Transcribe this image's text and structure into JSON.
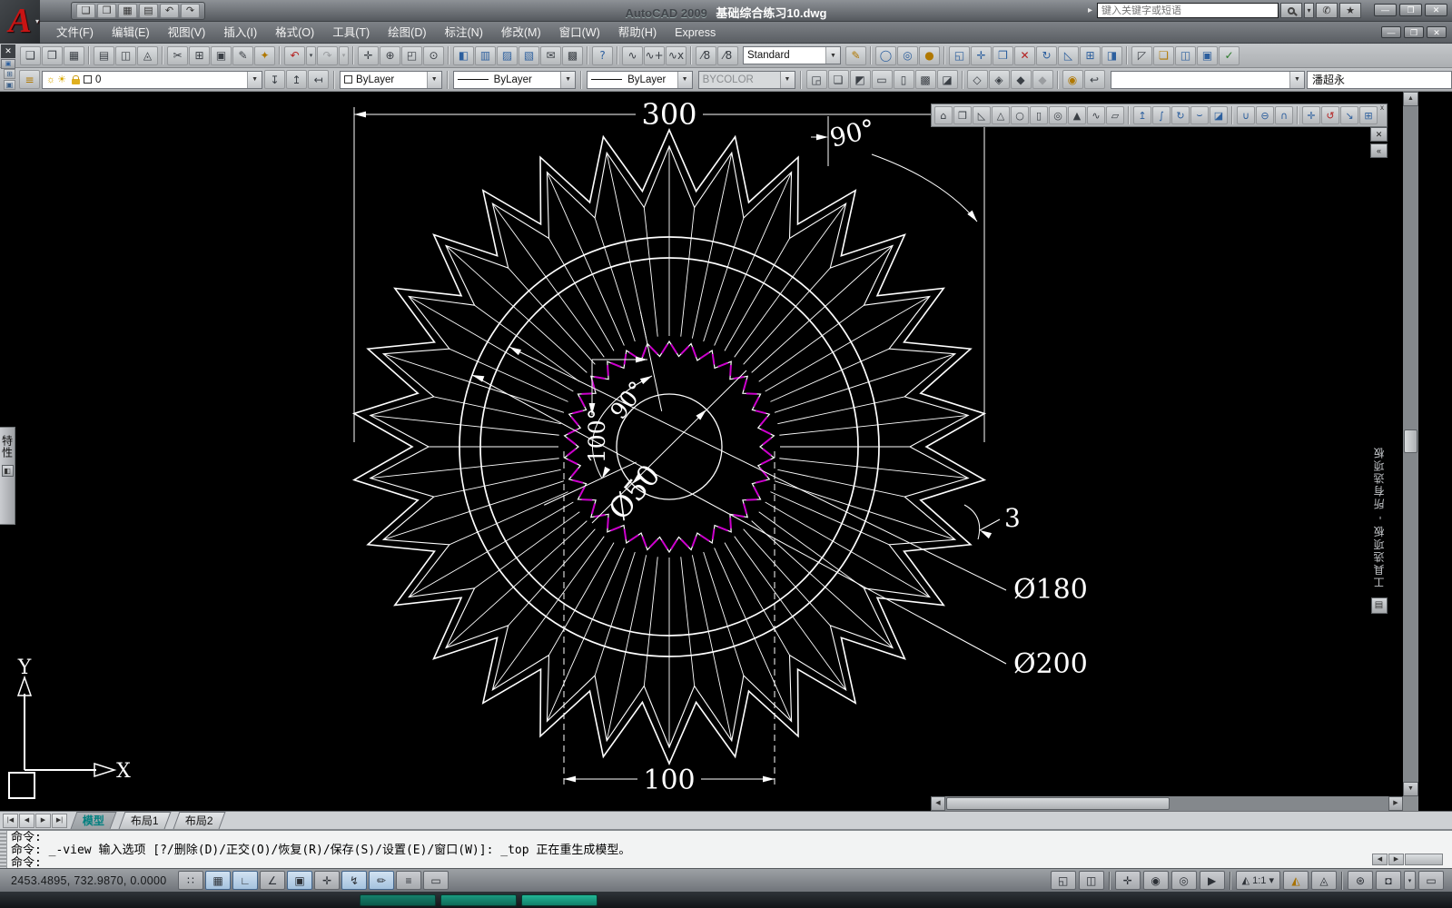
{
  "colors": {
    "dim_line": "#ffffff",
    "inner_gear_magenta": "#cc00cc",
    "tab_active_teal": "#007f7f"
  },
  "titlebar": {
    "app_label": "AutoCAD 2009",
    "doc_title": "基础综合练习10.dwg",
    "search_placeholder": "键入关键字或短语",
    "expand_arrow": "▸",
    "quick_icons": [
      {
        "name": "qnew-icon",
        "glyph": "❑"
      },
      {
        "name": "open-icon",
        "glyph": "❒"
      },
      {
        "name": "save-icon",
        "glyph": "▦"
      },
      {
        "name": "plot-icon",
        "glyph": "▤"
      },
      {
        "name": "undo-icon",
        "glyph": "↶"
      },
      {
        "name": "redo-icon",
        "glyph": "↷"
      }
    ],
    "search_buttons": [
      {
        "name": "search-dropdown",
        "glyph": "▾",
        "cls": "narrow"
      },
      {
        "name": "comm-center-icon",
        "glyph": "✆"
      },
      {
        "name": "favorites-star-icon",
        "glyph": "★"
      }
    ],
    "window_buttons": [
      {
        "name": "minimize-button",
        "glyph": "—"
      },
      {
        "name": "restore-button",
        "glyph": "❐"
      },
      {
        "name": "close-button",
        "glyph": "✕"
      }
    ],
    "doc_window_buttons": [
      {
        "name": "doc-minimize-button",
        "glyph": "—"
      },
      {
        "name": "doc-restore-button",
        "glyph": "❐"
      },
      {
        "name": "doc-close-button",
        "glyph": "✕"
      }
    ]
  },
  "menubar": {
    "items": [
      "文件(F)",
      "编辑(E)",
      "视图(V)",
      "插入(I)",
      "格式(O)",
      "工具(T)",
      "绘图(D)",
      "标注(N)",
      "修改(M)",
      "窗口(W)",
      "帮助(H)",
      "Express"
    ]
  },
  "left_dock": {
    "close_glyph": "✕",
    "grip_glyph": "▣"
  },
  "toolbar1": {
    "style_combo": "Standard",
    "icons": [
      {
        "name": "qnew-icon",
        "glyph": "❑"
      },
      {
        "name": "open-icon",
        "glyph": "❒"
      },
      {
        "name": "save-icon",
        "glyph": "▦"
      },
      {
        "sep": true
      },
      {
        "name": "plot-icon",
        "glyph": "▤"
      },
      {
        "name": "plot-preview-icon",
        "glyph": "◫"
      },
      {
        "name": "publish-icon",
        "glyph": "◬"
      },
      {
        "sep": true
      },
      {
        "name": "cut-icon",
        "glyph": "✂"
      },
      {
        "name": "copy-icon",
        "glyph": "⊞"
      },
      {
        "name": "paste-icon",
        "glyph": "▣"
      },
      {
        "name": "match-properties-icon",
        "glyph": "✎"
      },
      {
        "name": "block-editor-icon",
        "glyph": "✦",
        "cls": "warn"
      },
      {
        "sep": true
      },
      {
        "name": "undo-icon",
        "glyph": "↶",
        "cls": "red"
      },
      {
        "name": "undo-dropdown",
        "glyph": "▾",
        "cls": "drop"
      },
      {
        "name": "redo-icon",
        "glyph": "↷",
        "cls": "dim"
      },
      {
        "name": "redo-dropdown",
        "glyph": "▾",
        "cls": "drop dim"
      },
      {
        "sep": true
      },
      {
        "name": "pan-icon",
        "glyph": "✛"
      },
      {
        "name": "zoom-realtime-icon",
        "glyph": "⊕"
      },
      {
        "name": "zoom-window-icon",
        "glyph": "◰"
      },
      {
        "name": "zoom-previous-icon",
        "glyph": "⊙"
      },
      {
        "sep": true
      },
      {
        "name": "properties-icon",
        "glyph": "◧",
        "cls": "blue"
      },
      {
        "name": "designcenter-icon",
        "glyph": "▥",
        "cls": "blue"
      },
      {
        "name": "tool-palettes-icon",
        "glyph": "▨",
        "cls": "blue"
      },
      {
        "name": "sheetset-manager-icon",
        "glyph": "▧",
        "cls": "blue"
      },
      {
        "name": "markup-icon",
        "glyph": "✉"
      },
      {
        "name": "quickcalc-icon",
        "glyph": "▩"
      },
      {
        "sep": true
      },
      {
        "name": "help-icon",
        "glyph": "?",
        "cls": "blue"
      }
    ],
    "icons2": [
      {
        "name": "pline-edit-icon",
        "glyph": "∿"
      },
      {
        "name": "pline-join-icon",
        "glyph": "∿+"
      },
      {
        "name": "pline-break-icon",
        "glyph": "∿x"
      },
      {
        "sep": true
      },
      {
        "name": "dim-style-icon",
        "glyph": "⁄8"
      },
      {
        "name": "text-style-icon",
        "glyph": "⁄8"
      }
    ],
    "icons3": [
      {
        "name": "match-style-icon",
        "glyph": "✎",
        "cls": "warn"
      },
      {
        "sep": true
      },
      {
        "name": "render-region-icon",
        "glyph": "◯",
        "cls": "blue"
      },
      {
        "name": "render-icon",
        "glyph": "◎",
        "cls": "blue"
      },
      {
        "name": "render-presets-icon",
        "glyph": "●",
        "cls": "warn"
      },
      {
        "sep": true
      },
      {
        "name": "extrude-face-icon",
        "glyph": "◱",
        "cls": "blue"
      },
      {
        "name": "move-face-icon",
        "glyph": "✛",
        "cls": "blue"
      },
      {
        "name": "offset-face-icon",
        "glyph": "❒",
        "cls": "blue"
      },
      {
        "name": "delete-face-icon",
        "glyph": "✕",
        "cls": "red"
      },
      {
        "name": "rotate-face-icon",
        "glyph": "↻",
        "cls": "blue"
      },
      {
        "name": "taper-face-icon",
        "glyph": "◺",
        "cls": "blue"
      },
      {
        "name": "copy-face-icon",
        "glyph": "⊞",
        "cls": "blue"
      },
      {
        "name": "color-face-icon",
        "glyph": "◨",
        "cls": "blue"
      },
      {
        "sep": true
      },
      {
        "name": "imprint-icon",
        "glyph": "◸"
      },
      {
        "name": "clean-solid-icon",
        "glyph": "❏",
        "cls": "warn"
      },
      {
        "name": "separate-solid-icon",
        "glyph": "◫",
        "cls": "blue"
      },
      {
        "name": "shell-icon",
        "glyph": "▣",
        "cls": "blue"
      },
      {
        "name": "check-solid-icon",
        "glyph": "✓",
        "cls": "green"
      }
    ]
  },
  "toolbar2": {
    "minis": [
      {
        "name": "dock-grip1-icon",
        "glyph": "⊞"
      },
      {
        "name": "dock-grip2-icon",
        "glyph": "▣"
      }
    ],
    "layer_manager_glyph": "≡",
    "layer_bulb_glyph": "☼",
    "layer_sun_glyph": "☀",
    "layer_name": "0",
    "layer_icons": [
      {
        "name": "layer-states-icon",
        "glyph": "↧"
      },
      {
        "name": "layer-previous-icon",
        "glyph": "↥"
      },
      {
        "name": "make-object-layer-current-icon",
        "glyph": "↤"
      }
    ],
    "color_combo": "ByLayer",
    "linetype_combo": "ByLayer",
    "lineweight_combo": "ByLayer",
    "plotstyle_combo": "BYCOLOR",
    "vis_icons": [
      {
        "name": "view-page-icon",
        "glyph": "◲"
      },
      {
        "name": "box-2d-wireframe-icon",
        "glyph": "❏"
      },
      {
        "name": "box-3d-wireframe-icon",
        "glyph": "◩"
      },
      {
        "name": "box-3d-hidden-icon",
        "glyph": "▭"
      },
      {
        "name": "box-realistic-icon",
        "glyph": "▯"
      },
      {
        "name": "box-conceptual-icon",
        "glyph": "▩"
      },
      {
        "name": "box-shaded-icon",
        "glyph": "◪"
      },
      {
        "sep": true
      },
      {
        "name": "shade-flat-icon",
        "glyph": "◇"
      },
      {
        "name": "shade-gouraud-icon",
        "glyph": "◈"
      },
      {
        "name": "shade-flat-edges-icon",
        "glyph": "◆"
      },
      {
        "name": "shade-gouraud-edges-icon",
        "glyph": "◆",
        "cls": "dim"
      },
      {
        "sep": true
      },
      {
        "name": "camera-icon",
        "glyph": "◉",
        "cls": "warn"
      },
      {
        "name": "named-views-icon",
        "glyph": "↩"
      }
    ],
    "empty_combo": "",
    "user_field": "潘超永"
  },
  "modeling_toolbar": {
    "close_glyph": "x",
    "icons": [
      {
        "name": "polysolid-icon",
        "glyph": "⌂"
      },
      {
        "name": "box-icon",
        "glyph": "❒"
      },
      {
        "name": "wedge-icon",
        "glyph": "◺"
      },
      {
        "name": "cone-icon",
        "glyph": "△"
      },
      {
        "name": "sphere-icon",
        "glyph": "○"
      },
      {
        "name": "cylinder-icon",
        "glyph": "▯"
      },
      {
        "name": "torus-icon",
        "glyph": "◎"
      },
      {
        "name": "pyramid-icon",
        "glyph": "▲"
      },
      {
        "name": "helix-icon",
        "glyph": "∿"
      },
      {
        "name": "planar-surface-icon",
        "glyph": "▱"
      },
      {
        "sep": true
      },
      {
        "name": "presspull-icon",
        "glyph": "↥",
        "cls": "blue"
      },
      {
        "name": "sweep-icon",
        "glyph": "∫",
        "cls": "blue"
      },
      {
        "name": "revolve-icon",
        "glyph": "↻",
        "cls": "blue"
      },
      {
        "name": "loft-icon",
        "glyph": "⌣",
        "cls": "blue"
      },
      {
        "name": "slice-icon",
        "glyph": "◪",
        "cls": "blue"
      },
      {
        "sep": true
      },
      {
        "name": "union-icon",
        "glyph": "∪",
        "cls": "blue"
      },
      {
        "name": "subtract-icon",
        "glyph": "⊖",
        "cls": "blue"
      },
      {
        "name": "intersect-icon",
        "glyph": "∩",
        "cls": "blue"
      },
      {
        "sep": true
      },
      {
        "name": "3d-move-icon",
        "glyph": "✛",
        "cls": "blue"
      },
      {
        "name": "3d-rotate-icon",
        "glyph": "↺",
        "cls": "red"
      },
      {
        "name": "3d-align-icon",
        "glyph": "↘",
        "cls": "blue"
      },
      {
        "name": "3d-array-icon",
        "glyph": "⊞",
        "cls": "blue"
      }
    ]
  },
  "palette": {
    "title": "工具选项板 - 所有选项板",
    "close_glyph": "✕",
    "autohide_glyph": "«",
    "bottom_icon_glyph": "▤"
  },
  "props_tab": {
    "label": "特性",
    "icon_glyph": "◧"
  },
  "drawing": {
    "dim_300": "300",
    "dim_90_top": "90°",
    "dim_90_center": "90°",
    "dim_100_angle": "100°",
    "dim_d50": "Ø50",
    "dim_3": "3",
    "dim_d180": "Ø180",
    "dim_d200": "Ø200",
    "dim_100_bottom": "100",
    "axis_x": "X",
    "axis_y": "Y"
  },
  "scrollbars": {
    "v_up": "▲",
    "v_down": "▼",
    "h_left": "◀",
    "h_right": "▶"
  },
  "tabs": {
    "nav": [
      {
        "name": "tab-first-button",
        "glyph": "|◀"
      },
      {
        "name": "tab-prev-button",
        "glyph": "◀"
      },
      {
        "name": "tab-next-button",
        "glyph": "▶"
      },
      {
        "name": "tab-last-button",
        "glyph": "▶|"
      }
    ],
    "items": [
      {
        "name": "tab-model",
        "label": "模型",
        "active": true
      },
      {
        "name": "tab-layout1",
        "label": "布局1"
      },
      {
        "name": "tab-layout2",
        "label": "布局2"
      }
    ]
  },
  "command": {
    "lines": [
      "命令:",
      "命令: _-view 输入选项 [?/删除(D)/正交(O)/恢复(R)/保存(S)/设置(E)/窗口(W)]: _top 正在重生成模型。",
      "命令:"
    ],
    "scroll": [
      {
        "name": "cmd-scroll-left",
        "glyph": "◀"
      },
      {
        "name": "cmd-scroll-right",
        "glyph": "▶"
      }
    ]
  },
  "statusbar": {
    "coords": "2453.4895, 732.9870,  0.0000",
    "toggles": [
      {
        "name": "snap-toggle",
        "glyph": "∷"
      },
      {
        "name": "grid-toggle",
        "glyph": "▦",
        "pressed": true
      },
      {
        "name": "ortho-toggle",
        "glyph": "∟",
        "pressed": true
      },
      {
        "name": "polar-toggle",
        "glyph": "∠"
      },
      {
        "name": "osnap-toggle",
        "glyph": "▣",
        "pressed": true
      },
      {
        "name": "otrack-toggle",
        "glyph": "✛"
      },
      {
        "name": "ducs-toggle",
        "glyph": "↯",
        "pressed": true
      },
      {
        "name": "dyn-toggle",
        "glyph": "✏",
        "pressed": true
      },
      {
        "name": "lwt-toggle",
        "glyph": "≡"
      },
      {
        "name": "qp-toggle",
        "glyph": "▭"
      }
    ],
    "annotation_scale": "1:1",
    "right": [
      {
        "name": "model-space-button",
        "glyph": "◱"
      },
      {
        "name": "layout-space-button",
        "glyph": "◫"
      },
      {
        "sep": true
      },
      {
        "name": "pan-button",
        "glyph": "✛"
      },
      {
        "name": "zoom-button",
        "glyph": "◉"
      },
      {
        "name": "steering-wheel-button",
        "glyph": "◎"
      },
      {
        "name": "showmotion-button",
        "glyph": "▶"
      },
      {
        "sep": true
      },
      {
        "name": "annotation-scale-button",
        "glyph": "◭ 1:1 ▾",
        "cls": "wide"
      },
      {
        "name": "annotation-visibility-button",
        "glyph": "◭",
        "cls": "warn"
      },
      {
        "name": "auto-annotate-button",
        "glyph": "◬"
      },
      {
        "sep": true
      },
      {
        "name": "workspace-switch-button",
        "glyph": "⊛"
      },
      {
        "name": "lock-ui-button",
        "glyph": "◘"
      },
      {
        "name": "status-menu-arrow",
        "glyph": "▾",
        "cls": "drop"
      },
      {
        "name": "clean-screen-button",
        "glyph": "▭"
      }
    ]
  },
  "taskbar_items": [
    {
      "name": "taskbar-item",
      "cls": "g1"
    },
    {
      "name": "taskbar-item",
      "cls": "g2"
    },
    {
      "name": "taskbar-item",
      "cls": "g3"
    }
  ]
}
